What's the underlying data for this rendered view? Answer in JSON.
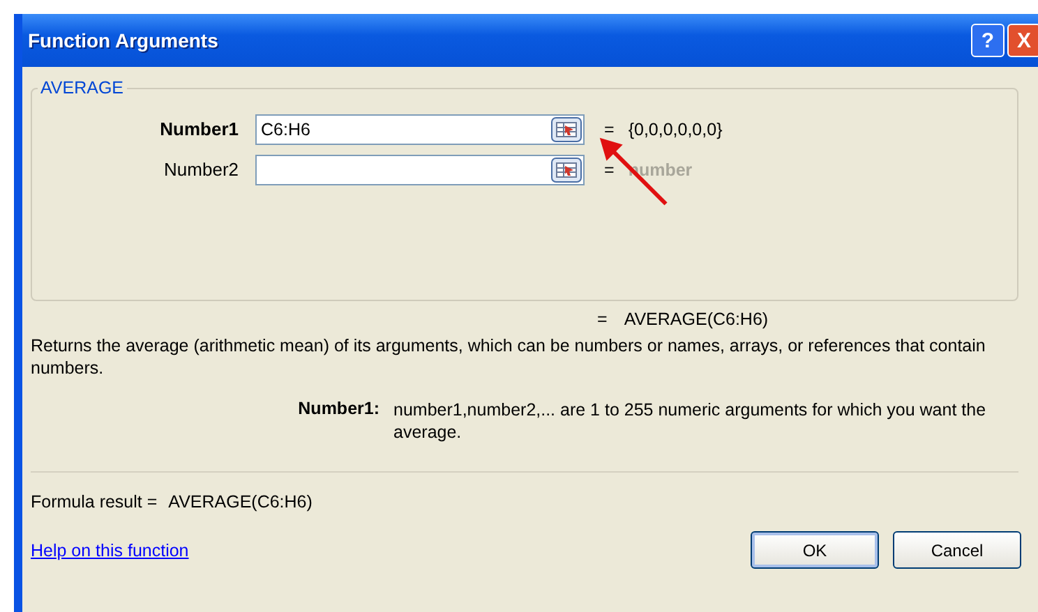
{
  "window": {
    "title": "Function Arguments",
    "title_buttons": [
      "?",
      "X"
    ]
  },
  "function_group": {
    "name": "AVERAGE",
    "arguments": [
      {
        "label": "Number1",
        "value": "C6:H6",
        "bold": true,
        "equals": "=",
        "result": "{0,0,0,0,0,0}",
        "result_dim": false
      },
      {
        "label": "Number2",
        "bold": false,
        "equals": "=",
        "result": "number",
        "result_dim": true
      }
    ]
  },
  "formula_preview": {
    "equals": "=",
    "value": "AVERAGE(C6:H6)"
  },
  "description": "Returns the average (arithmetic mean) of its arguments, which can be numbers or names, arrays, or references that contain numbers.",
  "argument_help": {
    "label": "Number1:",
    "text": "number1,number2,... are 1 to 255 numeric arguments for which you want the average."
  },
  "formula_result": {
    "label": "Formula result =",
    "value": "AVERAGE(C6:H6)"
  },
  "help_link": "Help on this function",
  "buttons": [
    {
      "label": "OK",
      "default": true
    },
    {
      "label": "Cancel",
      "default": false
    }
  ]
}
